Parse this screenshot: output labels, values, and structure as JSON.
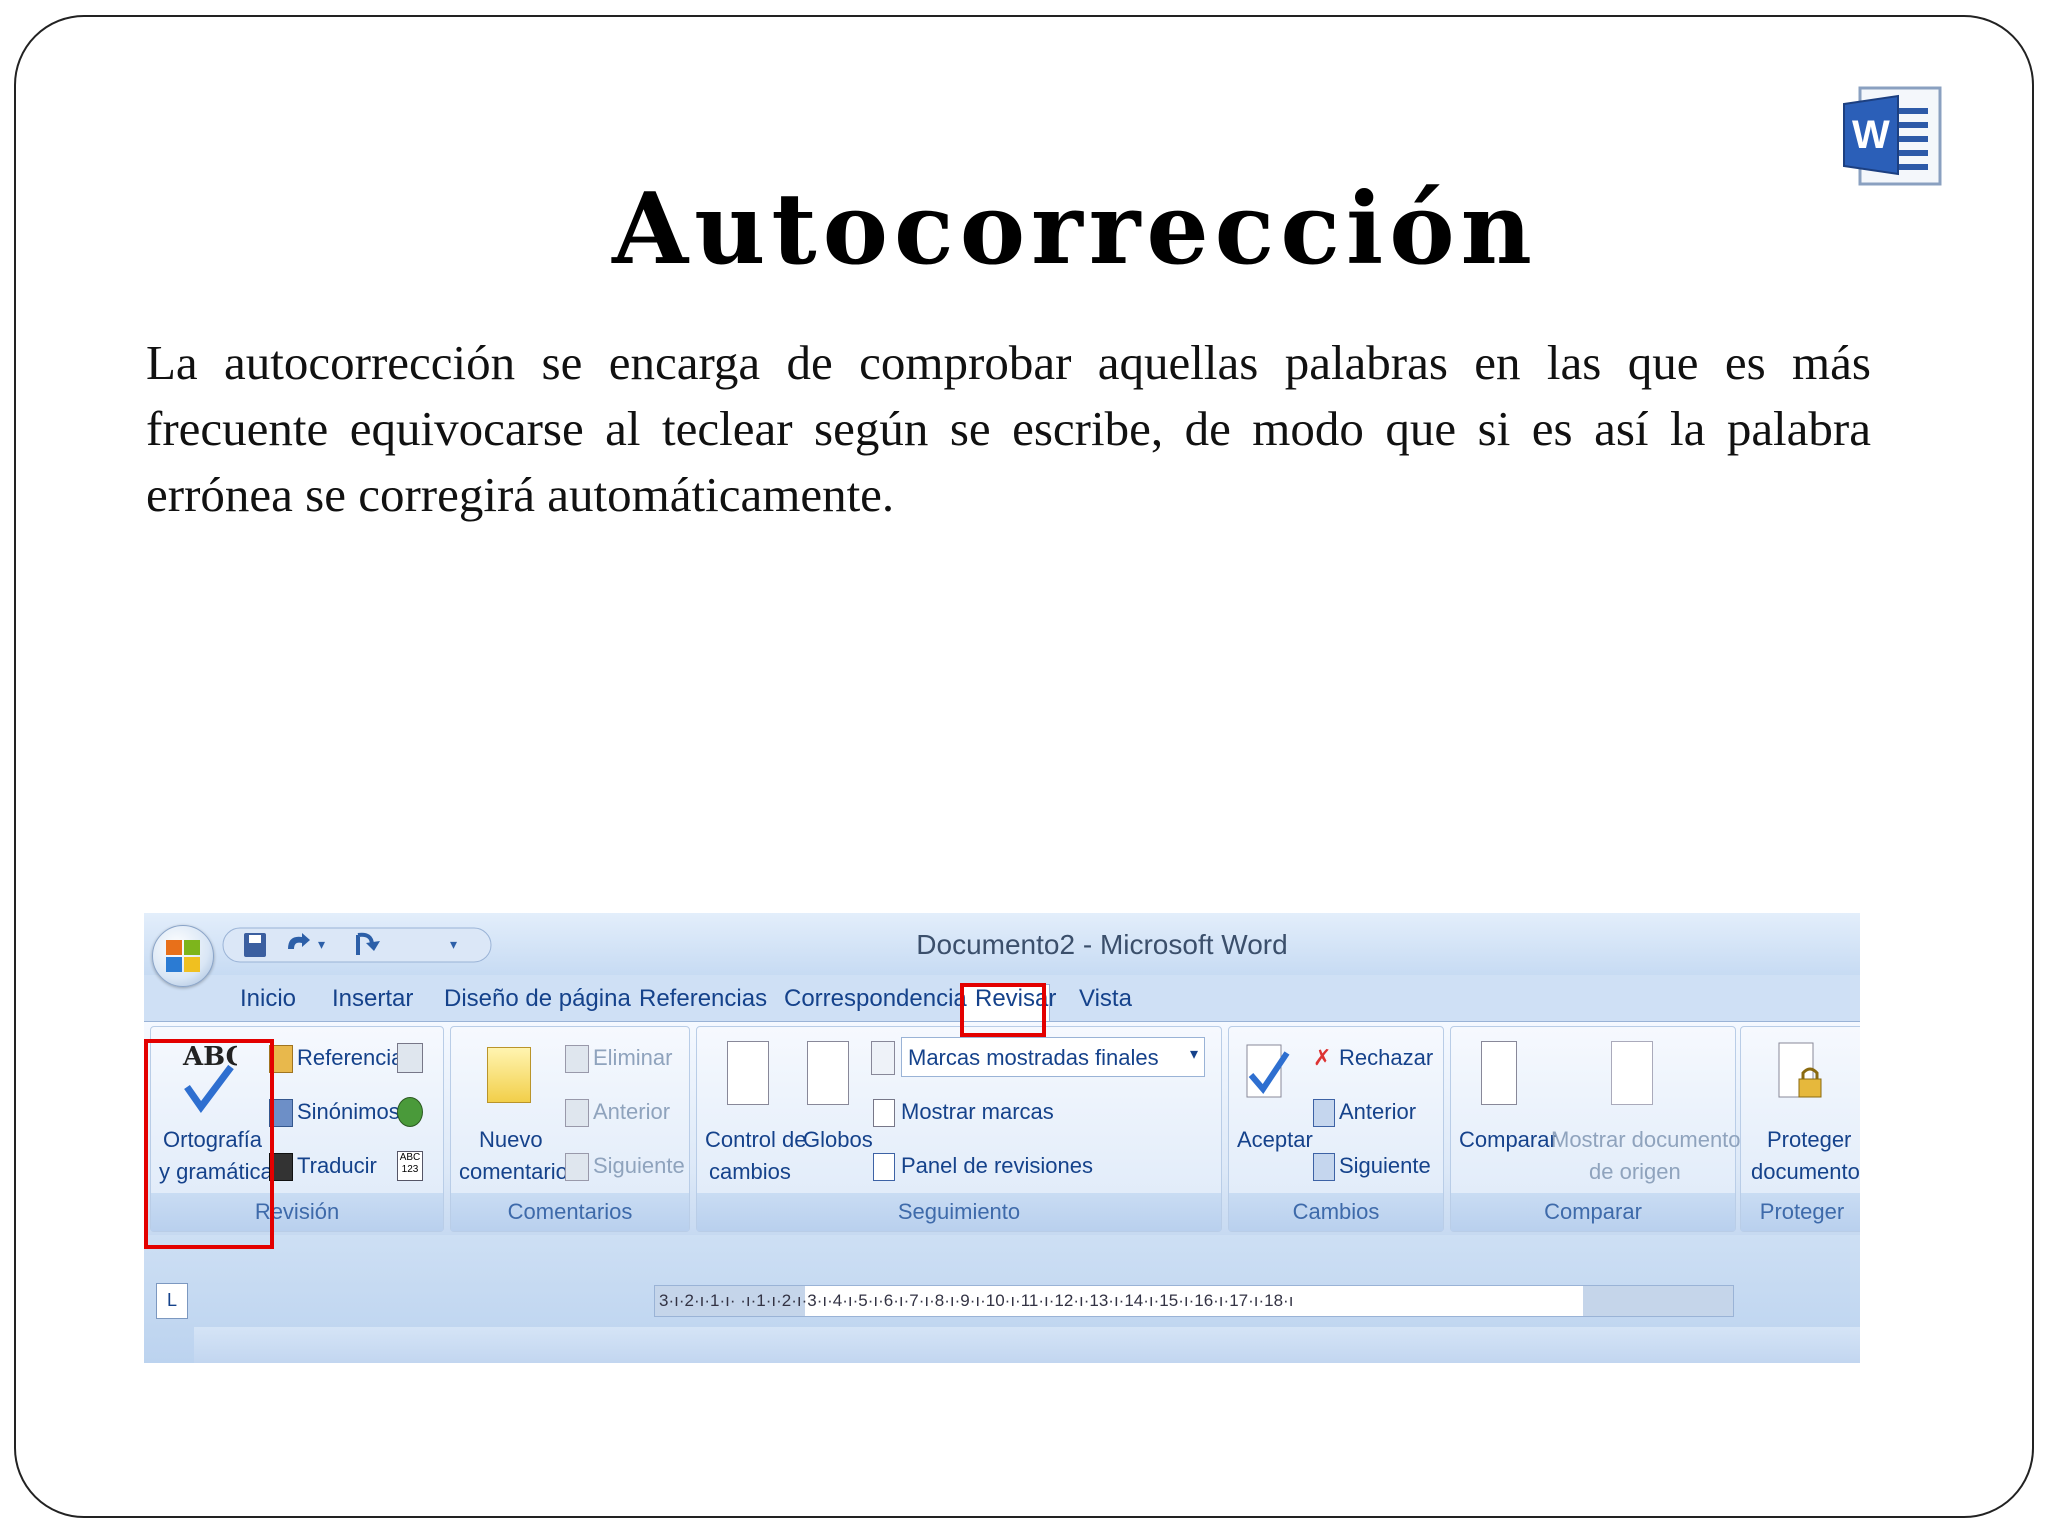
{
  "slide": {
    "title": "Autocorrección",
    "body": "La autocorrección se encarga de comprobar aquellas palabras en las que es más frecuente equivocarse al teclear según se escribe, de modo que si es así la palabra errónea se corregirá automáticamente."
  },
  "word_window": {
    "title": "Documento2 - Microsoft Word",
    "tabs": [
      "Inicio",
      "Insertar",
      "Diseño de página",
      "Referencias",
      "Correspondencia",
      "Revisar",
      "Vista"
    ],
    "active_tab": "Revisar",
    "groups": {
      "revision": {
        "label": "Revisión",
        "spelling_line1": "Ortografía",
        "spelling_line2": "y gramática",
        "referencia": "Referencia",
        "sinonimos": "Sinónimos",
        "traducir": "Traducir"
      },
      "comentarios": {
        "label": "Comentarios",
        "nuevo_line1": "Nuevo",
        "nuevo_line2": "comentario",
        "eliminar": "Eliminar",
        "anterior": "Anterior",
        "siguiente": "Siguiente"
      },
      "seguimiento": {
        "label": "Seguimiento",
        "control_line1": "Control de",
        "control_line2": "cambios",
        "globos": "Globos",
        "marcas_select": "Marcas mostradas finales",
        "mostrar_marcas": "Mostrar marcas",
        "panel": "Panel de revisiones"
      },
      "cambios": {
        "label": "Cambios",
        "aceptar": "Aceptar",
        "rechazar": "Rechazar",
        "anterior": "Anterior",
        "siguiente": "Siguiente"
      },
      "comparar": {
        "label": "Comparar",
        "comparar": "Comparar",
        "mostrar_line1": "Mostrar documentos",
        "mostrar_line2": "de origen"
      },
      "proteger": {
        "label": "Proteger",
        "line1": "Proteger",
        "line2": "documento"
      }
    },
    "ruler_text": "3·ı·2·ı·1·ı· ·ı·1·ı·2·ı·3·ı·4·ı·5·ı·6·ı·7·ı·8·ı·9·ı·10·ı·11·ı·12·ı·13·ı·14·ı·15·ı·16·ı·17·ı·18·ı",
    "tab_selector": "L"
  },
  "colors": {
    "highlight": "#e30000",
    "ribbon_text": "#15428b"
  }
}
